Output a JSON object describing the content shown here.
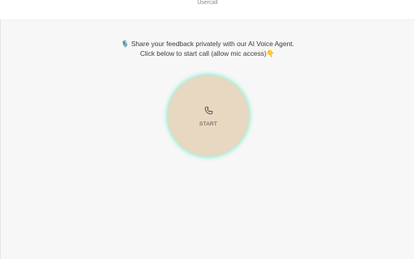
{
  "header": {
    "brand": "Usercall"
  },
  "intro": {
    "line1": "🎙️ Share your feedback privately with our AI Voice Agent.",
    "line2": "Click below to start call (allow mic access)👇"
  },
  "call_button": {
    "label": "START",
    "icon": "phone-icon"
  },
  "colors": {
    "background": "#f7f7f7",
    "button_fill": "#e8d7c1",
    "button_ring": "#b9f0de"
  }
}
